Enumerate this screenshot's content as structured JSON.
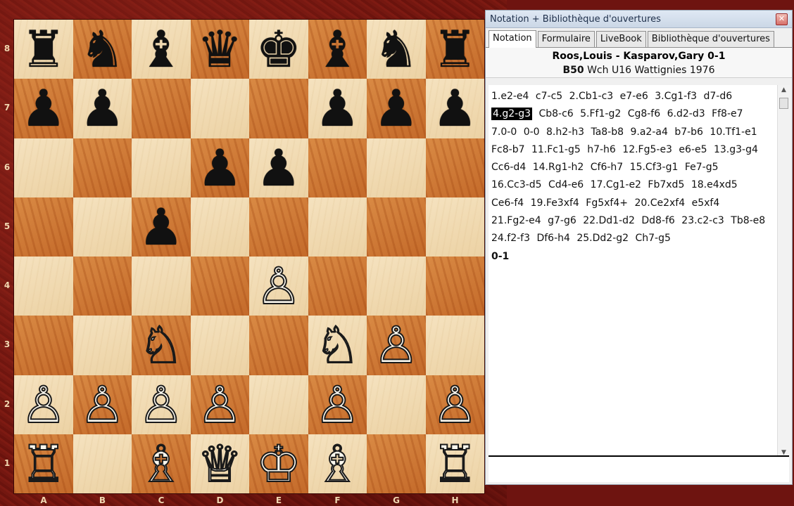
{
  "board": {
    "ranks": [
      "8",
      "7",
      "6",
      "5",
      "4",
      "3",
      "2",
      "1"
    ],
    "files": [
      "A",
      "B",
      "C",
      "D",
      "E",
      "F",
      "G",
      "H"
    ],
    "rows": [
      [
        "r",
        "n",
        "b",
        "q",
        "k",
        "b",
        "n",
        "r"
      ],
      [
        "p",
        "p",
        "",
        "",
        "",
        "p",
        "p",
        "p"
      ],
      [
        "",
        "",
        "",
        "p",
        "p",
        "",
        "",
        ""
      ],
      [
        "",
        "",
        "p",
        "",
        "",
        "",
        "",
        ""
      ],
      [
        "",
        "",
        "",
        "",
        "P",
        "",
        "",
        ""
      ],
      [
        "",
        "",
        "N",
        "",
        "",
        "N",
        "P",
        ""
      ],
      [
        "P",
        "P",
        "P",
        "P",
        "",
        "P",
        "",
        "P"
      ],
      [
        "R",
        "",
        "B",
        "Q",
        "K",
        "B",
        "",
        "R"
      ]
    ],
    "glyphs": {
      "k": "♚",
      "q": "♛",
      "r": "♜",
      "b": "♝",
      "n": "♞",
      "p": "♟",
      "K": "♔",
      "Q": "♕",
      "R": "♖",
      "B": "♗",
      "N": "♘",
      "P": "♙"
    },
    "colors": {
      "light": "#f0dbb4",
      "dark": "#cf7a36",
      "frame": "#6e1410"
    }
  },
  "panel": {
    "title": "Notation + Bibliothèque d'ouvertures",
    "tabs": [
      {
        "label": "Notation",
        "active": true
      },
      {
        "label": "Formulaire",
        "active": false
      },
      {
        "label": "LiveBook",
        "active": false
      },
      {
        "label": "Bibliothèque d'ouvertures",
        "active": false
      }
    ],
    "header": {
      "players": "Roos,Louis - Kasparov,Gary  0-1",
      "eco": "B50",
      "event": " Wch U16 Wattignies 1976"
    },
    "moves": [
      "1.e2-e4",
      "c7-c5",
      "2.Cb1-c3",
      "e7-e6",
      "3.Cg1-f3",
      "d7-d6",
      "4.g2-g3",
      "Cb8-c6",
      "5.Ff1-g2",
      "Cg8-f6",
      "6.d2-d3",
      "Ff8-e7",
      "7.0-0",
      "0-0",
      "8.h2-h3",
      "Ta8-b8",
      "9.a2-a4",
      "b7-b6",
      "10.Tf1-e1",
      "Fc8-b7",
      "11.Fc1-g5",
      "h7-h6",
      "12.Fg5-e3",
      "e6-e5",
      "13.g3-g4",
      "Cc6-d4",
      "14.Rg1-h2",
      "Cf6-h7",
      "15.Cf3-g1",
      "Fe7-g5",
      "16.Cc3-d5",
      "Cd4-e6",
      "17.Cg1-e2",
      "Fb7xd5",
      "18.e4xd5",
      "Ce6-f4",
      "19.Fe3xf4",
      "Fg5xf4+",
      "20.Ce2xf4",
      "e5xf4",
      "21.Fg2-e4",
      "g7-g6",
      "22.Dd1-d2",
      "Dd8-f6",
      "23.c2-c3",
      "Tb8-e8",
      "24.f2-f3",
      "Df6-h4",
      "25.Dd2-g2",
      "Ch7-g5"
    ],
    "selected_move_index": 6,
    "result": "0-1",
    "close_icon": "close-icon",
    "scroll_up": "▲",
    "scroll_down": "▼"
  }
}
